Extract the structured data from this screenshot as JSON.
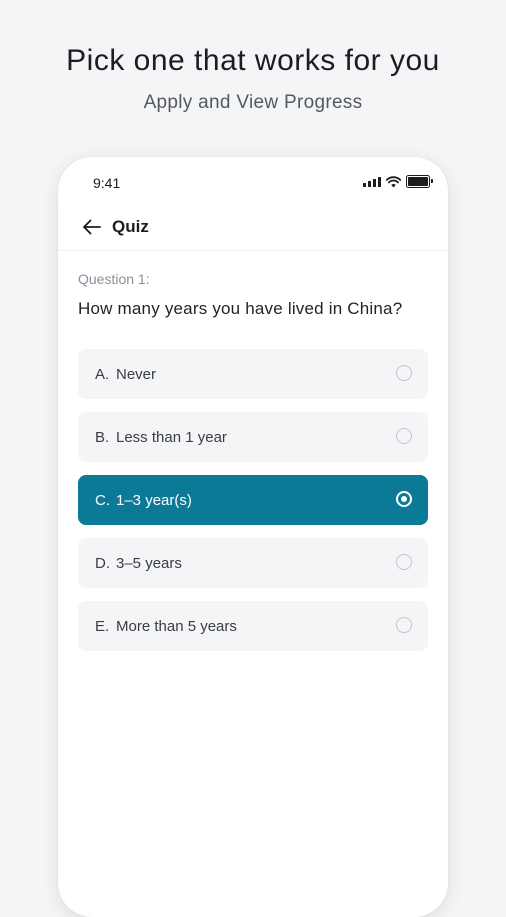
{
  "promo": {
    "title": "Pick one that works for you",
    "subtitle": "Apply and View Progress"
  },
  "status_bar": {
    "time": "9:41",
    "icons": [
      "signal-icon",
      "wifi-icon",
      "battery-icon"
    ]
  },
  "nav": {
    "back_icon": "arrow-left-icon",
    "title": "Quiz"
  },
  "question": {
    "number": "Question 1:",
    "text": "How many years you have lived in China?"
  },
  "options": [
    {
      "letter": "A.",
      "label": "Never",
      "selected": false
    },
    {
      "letter": "B.",
      "label": "Less than 1 year",
      "selected": false
    },
    {
      "letter": "C.",
      "label": "1–3 year(s)",
      "selected": true
    },
    {
      "letter": "D.",
      "label": "3–5 years",
      "selected": false
    },
    {
      "letter": "E.",
      "label": "More than 5 years",
      "selected": false
    }
  ],
  "colors": {
    "accent": "#0b7a97",
    "background": "#f4f5f7",
    "option_background": "#f4f5f7"
  }
}
